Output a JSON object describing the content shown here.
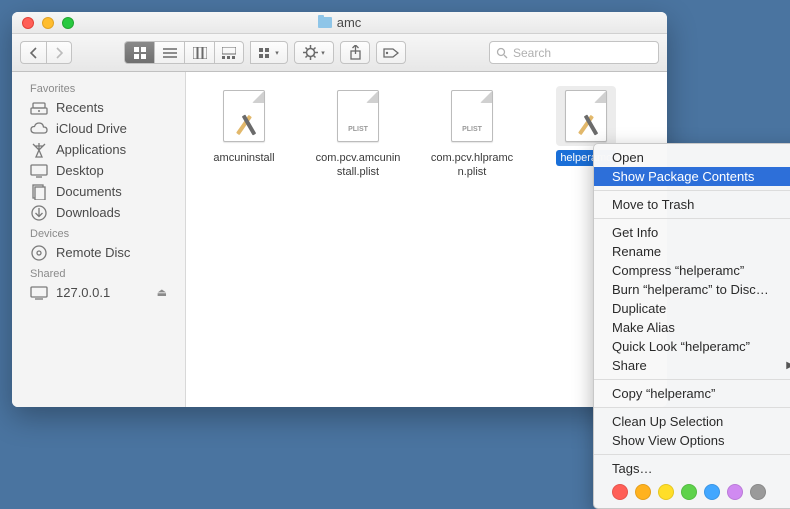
{
  "window": {
    "title": "amc"
  },
  "toolbar": {
    "search_placeholder": "Search"
  },
  "sidebar": {
    "sections": [
      {
        "header": "Favorites",
        "items": [
          {
            "label": "Recents",
            "icon": "recents"
          },
          {
            "label": "iCloud Drive",
            "icon": "icloud"
          },
          {
            "label": "Applications",
            "icon": "applications"
          },
          {
            "label": "Desktop",
            "icon": "desktop"
          },
          {
            "label": "Documents",
            "icon": "documents"
          },
          {
            "label": "Downloads",
            "icon": "downloads"
          }
        ]
      },
      {
        "header": "Devices",
        "items": [
          {
            "label": "Remote Disc",
            "icon": "disc"
          }
        ]
      },
      {
        "header": "Shared",
        "items": [
          {
            "label": "127.0.0.1",
            "icon": "network",
            "eject": true
          }
        ]
      }
    ]
  },
  "files": [
    {
      "label": "amcuninstall",
      "kind": "app",
      "selected": false
    },
    {
      "label": "com.pcv.amcuninstall.plist",
      "kind": "plist",
      "selected": false
    },
    {
      "label": "com.pcv.hlpramcn.plist",
      "kind": "plist",
      "selected": false
    },
    {
      "label": "helperamc",
      "kind": "app",
      "selected": true
    }
  ],
  "context_menu": {
    "groups": [
      [
        {
          "label": "Open"
        },
        {
          "label": "Show Package Contents",
          "highlighted": true
        }
      ],
      [
        {
          "label": "Move to Trash"
        }
      ],
      [
        {
          "label": "Get Info"
        },
        {
          "label": "Rename"
        },
        {
          "label": "Compress “helperamc”"
        },
        {
          "label": "Burn “helperamc” to Disc…"
        },
        {
          "label": "Duplicate"
        },
        {
          "label": "Make Alias"
        },
        {
          "label": "Quick Look “helperamc”"
        },
        {
          "label": "Share",
          "submenu": true
        }
      ],
      [
        {
          "label": "Copy “helperamc”"
        }
      ],
      [
        {
          "label": "Clean Up Selection"
        },
        {
          "label": "Show View Options"
        }
      ],
      [
        {
          "label": "Tags…"
        }
      ]
    ],
    "tag_colors": [
      "#ff5f57",
      "#ffb21e",
      "#ffde28",
      "#5ed24b",
      "#42a7ff",
      "#d08af1",
      "#9a9a9a"
    ]
  }
}
